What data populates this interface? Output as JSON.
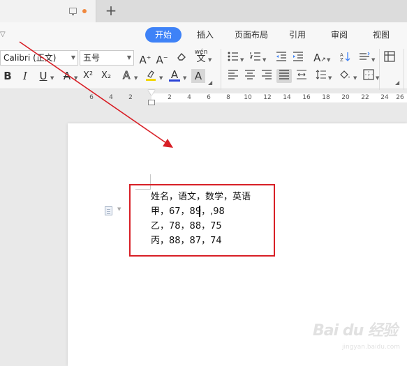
{
  "tabs": {
    "monitor_icon": "monitor-icon",
    "new_tab": "+"
  },
  "ribbon": {
    "collapse_glyph": "▽",
    "menu": [
      "开始",
      "插入",
      "页面布局",
      "引用",
      "审阅",
      "视图"
    ],
    "font_name": "Calibri (正文)",
    "font_size": "五号",
    "tools_row1": [
      "A⁺",
      "A⁻",
      "clear-format-icon",
      "wen",
      "bullet-list-icon",
      "numbered-list-icon",
      "decrease-indent-icon",
      "increase-indent-icon",
      "text-direction-icon",
      "sort-icon",
      "line-spacing-icon",
      "table-icon"
    ],
    "wen_label": "wén",
    "tools_row2": [
      "B",
      "I",
      "U",
      "A",
      "X²",
      "X₂",
      "A",
      "highlight-icon",
      "A",
      "A"
    ],
    "accent_color": "#3e82f7",
    "highlight_color": "#f2d600",
    "font_color": "#d81f26"
  },
  "ruler": {
    "numbers": [
      "6",
      "4",
      "2",
      "2",
      "4",
      "6",
      "8",
      "10",
      "12",
      "14",
      "16",
      "18",
      "20",
      "22",
      "24",
      "26"
    ]
  },
  "document": {
    "lines": [
      "姓名，语文，数学，英语",
      "甲，67，89，,98",
      "乙，78，88，75",
      "丙，88，87，74"
    ]
  },
  "annotation": {
    "box_color": "#d81f26",
    "arrow_color": "#d81f26"
  },
  "watermark": {
    "logo": "Bai du 经验",
    "url": "jingyan.baidu.com"
  }
}
